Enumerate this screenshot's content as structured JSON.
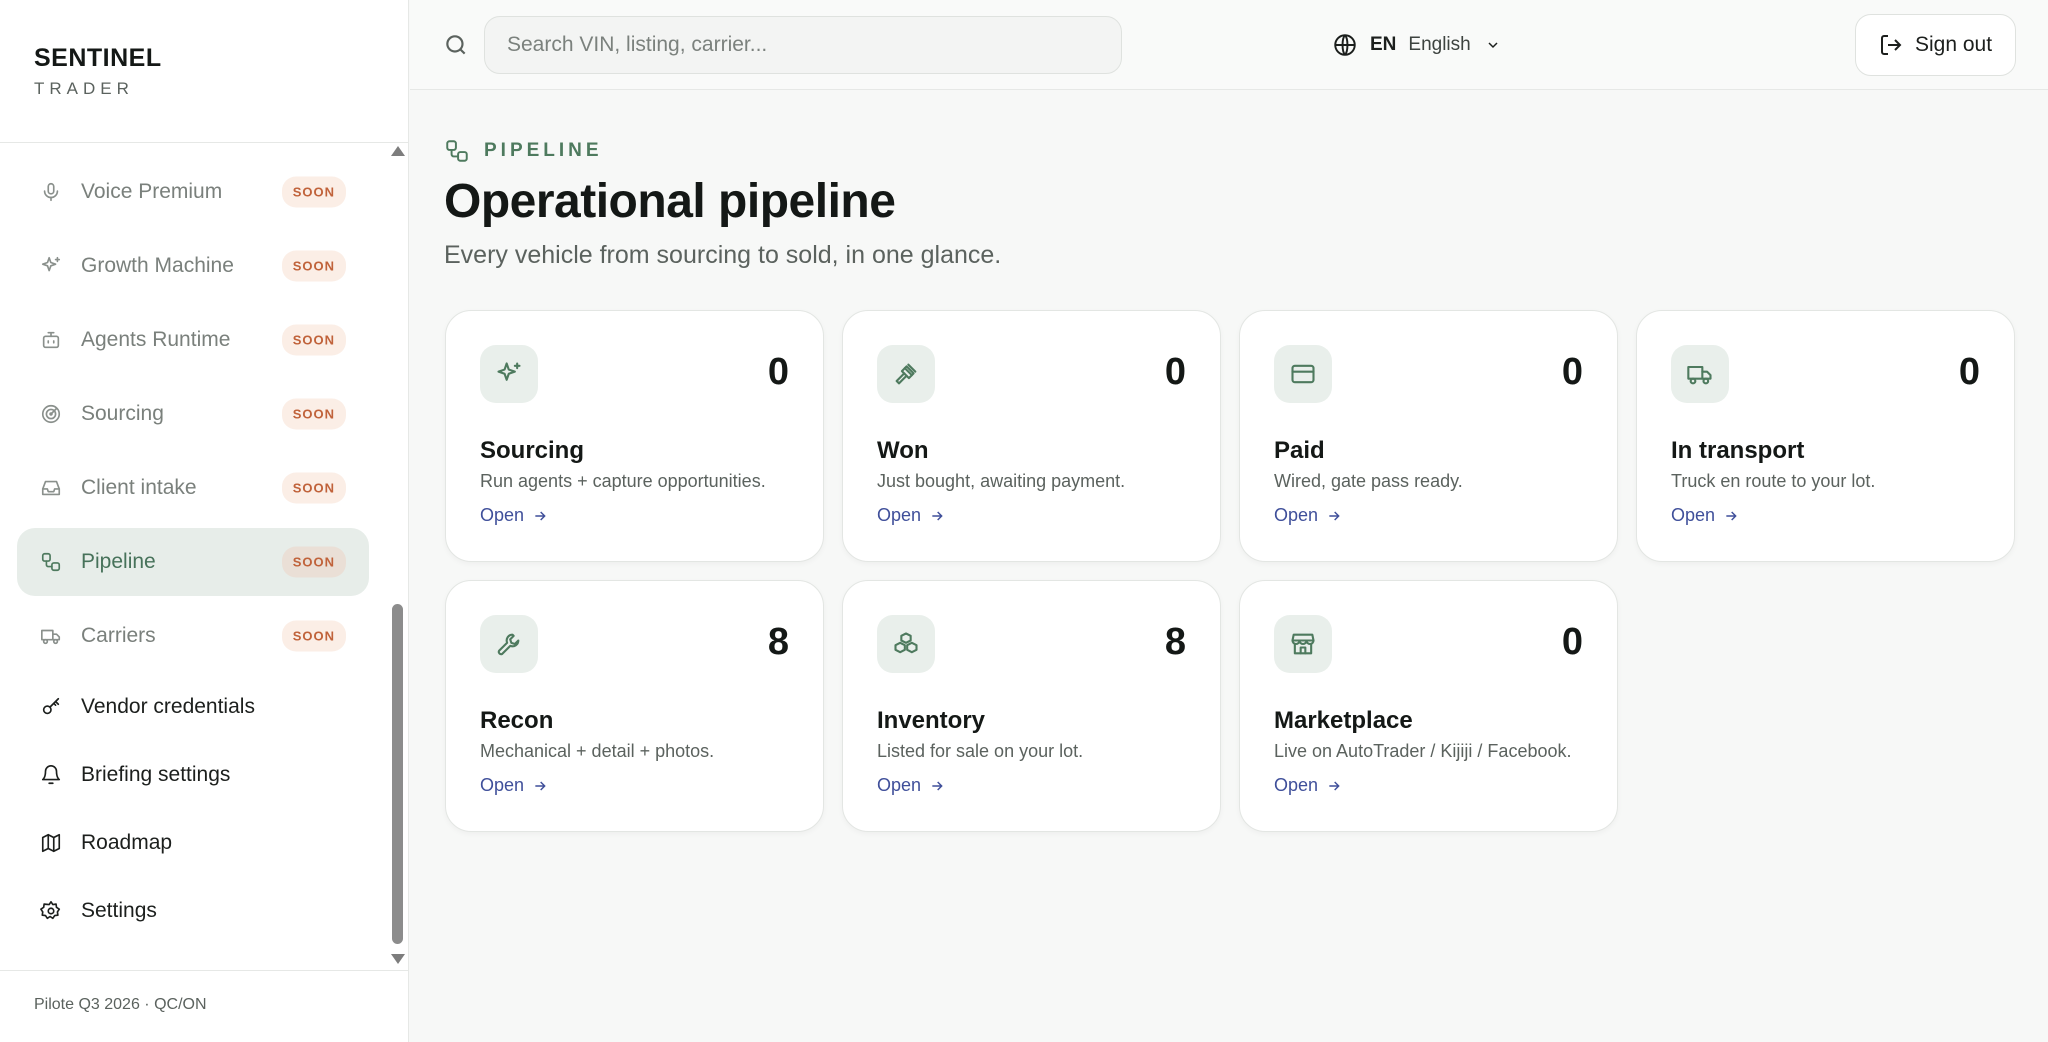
{
  "brand": {
    "name": "SENTINEL",
    "sub": "TRADER"
  },
  "sidebar": {
    "items": [
      {
        "label": "Voice Premium",
        "badge": "SOON",
        "icon": "mic-icon"
      },
      {
        "label": "Growth Machine",
        "badge": "SOON",
        "icon": "sparkles-icon"
      },
      {
        "label": "Agents Runtime",
        "badge": "SOON",
        "icon": "bot-icon"
      },
      {
        "label": "Sourcing",
        "badge": "SOON",
        "icon": "radar-icon"
      },
      {
        "label": "Client intake",
        "badge": "SOON",
        "icon": "inbox-icon"
      },
      {
        "label": "Pipeline",
        "badge": "SOON",
        "icon": "workflow-icon",
        "active": true
      },
      {
        "label": "Carriers",
        "badge": "SOON",
        "icon": "truck-icon"
      },
      {
        "label": "Vendor credentials",
        "icon": "key-icon"
      },
      {
        "label": "Briefing settings",
        "icon": "bell-icon"
      },
      {
        "label": "Roadmap",
        "icon": "map-icon"
      },
      {
        "label": "Settings",
        "icon": "gear-icon"
      }
    ],
    "footer": "Pilote Q3 2026 · QC/ON"
  },
  "header": {
    "search_placeholder": "Search VIN, listing, carrier...",
    "lang_code": "EN",
    "lang_name": "English",
    "signout_label": "Sign out"
  },
  "main": {
    "eyebrow": "PIPELINE",
    "title": "Operational pipeline",
    "subtitle": "Every vehicle from sourcing to sold, in one glance.",
    "cards": [
      {
        "title": "Sourcing",
        "desc": "Run agents + capture opportunities.",
        "count": "0",
        "link": "Open",
        "icon": "sparkles-icon"
      },
      {
        "title": "Won",
        "desc": "Just bought, awaiting payment.",
        "count": "0",
        "link": "Open",
        "icon": "gavel-icon"
      },
      {
        "title": "Paid",
        "desc": "Wired, gate pass ready.",
        "count": "0",
        "link": "Open",
        "icon": "credit-card-icon"
      },
      {
        "title": "In transport",
        "desc": "Truck en route to your lot.",
        "count": "0",
        "link": "Open",
        "icon": "truck-icon"
      },
      {
        "title": "Recon",
        "desc": "Mechanical + detail + photos.",
        "count": "8",
        "link": "Open",
        "icon": "wrench-icon"
      },
      {
        "title": "Inventory",
        "desc": "Listed for sale on your lot.",
        "count": "8",
        "link": "Open",
        "icon": "boxes-icon"
      },
      {
        "title": "Marketplace",
        "desc": "Live on AutoTrader / Kijiji / Facebook.",
        "count": "0",
        "link": "Open",
        "icon": "store-icon"
      }
    ]
  },
  "colors": {
    "accent": "#4e7a5e",
    "soon_badge_bg": "#fbeee6",
    "soon_badge_text": "#c0623a",
    "link": "#3f4f9a"
  }
}
